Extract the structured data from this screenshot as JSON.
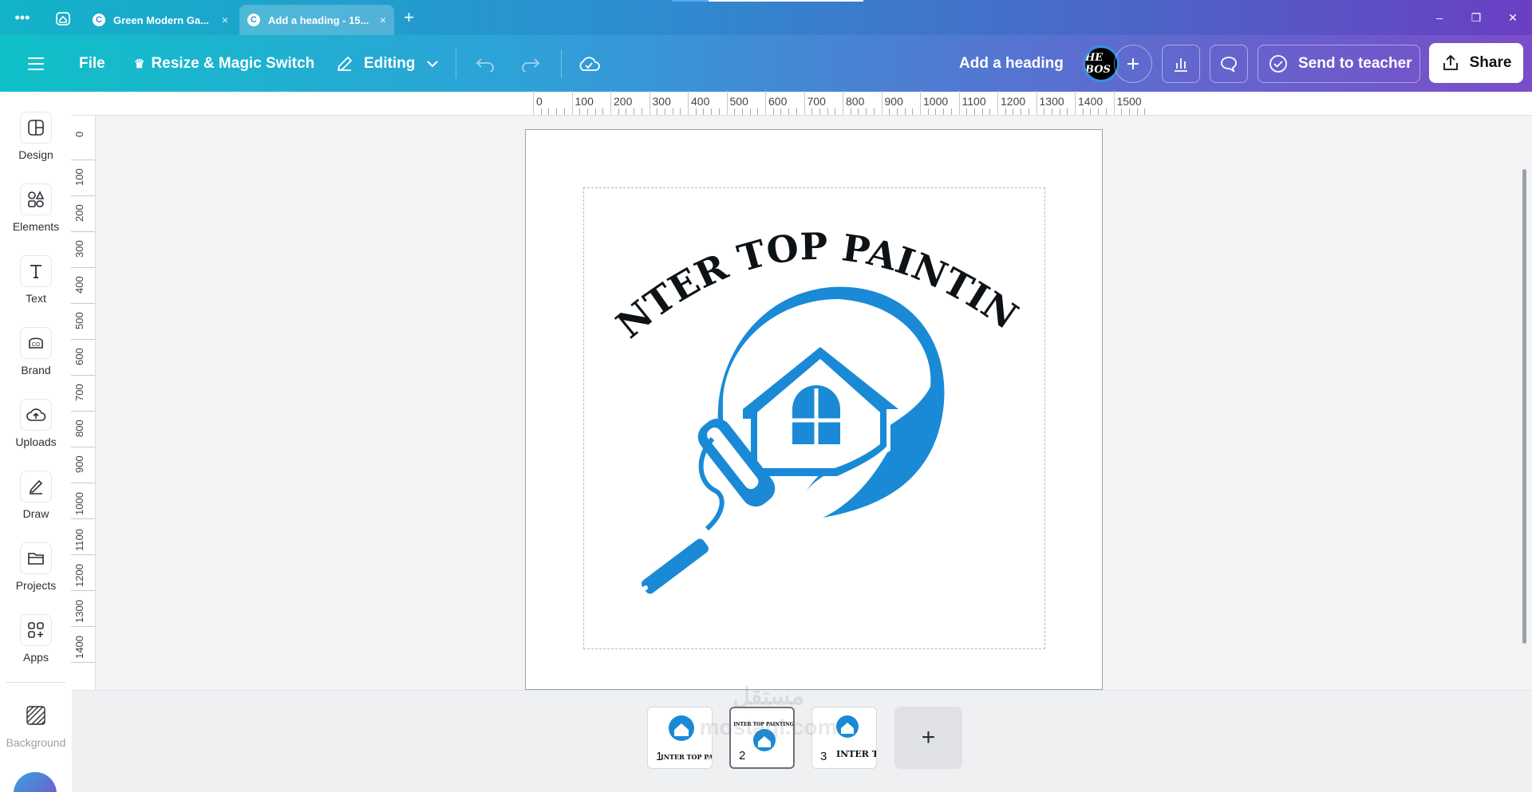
{
  "browser": {
    "tabs": [
      {
        "label": "Green Modern Ga...",
        "close": "×"
      },
      {
        "label": "Add a heading - 15...",
        "close": "×"
      }
    ],
    "new_tab": "+",
    "window_controls": {
      "minimize": "–",
      "restore": "❐",
      "close": "✕"
    }
  },
  "toolbar": {
    "file": "File",
    "resize": "Resize & Magic Switch",
    "editing": "Editing",
    "title": "Add a heading",
    "avatar_text": "HE BOS",
    "send_to_teacher": "Send to teacher",
    "share": "Share"
  },
  "sidebar": {
    "items": [
      {
        "label": "Design",
        "icon": "design-icon"
      },
      {
        "label": "Elements",
        "icon": "elements-icon"
      },
      {
        "label": "Text",
        "icon": "text-icon"
      },
      {
        "label": "Brand",
        "icon": "brand-icon"
      },
      {
        "label": "Uploads",
        "icon": "uploads-icon"
      },
      {
        "label": "Draw",
        "icon": "draw-icon"
      },
      {
        "label": "Projects",
        "icon": "projects-icon"
      },
      {
        "label": "Apps",
        "icon": "apps-icon"
      },
      {
        "label": "Background",
        "icon": "background-icon"
      }
    ]
  },
  "ruler": {
    "top_labels": [
      "0",
      "100",
      "200",
      "300",
      "400",
      "500",
      "600",
      "700",
      "800",
      "900",
      "1000",
      "1100",
      "1200",
      "1300",
      "1400",
      "1500"
    ],
    "left_labels": [
      "0",
      "100",
      "200",
      "300",
      "400",
      "500",
      "600",
      "700",
      "800",
      "900",
      "1000",
      "1100",
      "1200",
      "1300",
      "1400"
    ]
  },
  "design": {
    "logo_text": "INTER TOP PAINTING",
    "logo_color": "#1a8ad6",
    "text_color": "#0d1216"
  },
  "pages": {
    "thumbnails": [
      {
        "number": "1",
        "caption": "INTER TOP PAINTING"
      },
      {
        "number": "2",
        "caption": "INTER TOP PAINTING"
      },
      {
        "number": "3",
        "caption": "INTER TOP"
      }
    ],
    "active_page": 2,
    "add_page": "+"
  },
  "watermark": {
    "line1": "مستقل",
    "line2": "mostaql.com"
  },
  "colors": {
    "accent_gradient_start": "#0fc1c8",
    "accent_gradient_end": "#7a4dc8"
  }
}
